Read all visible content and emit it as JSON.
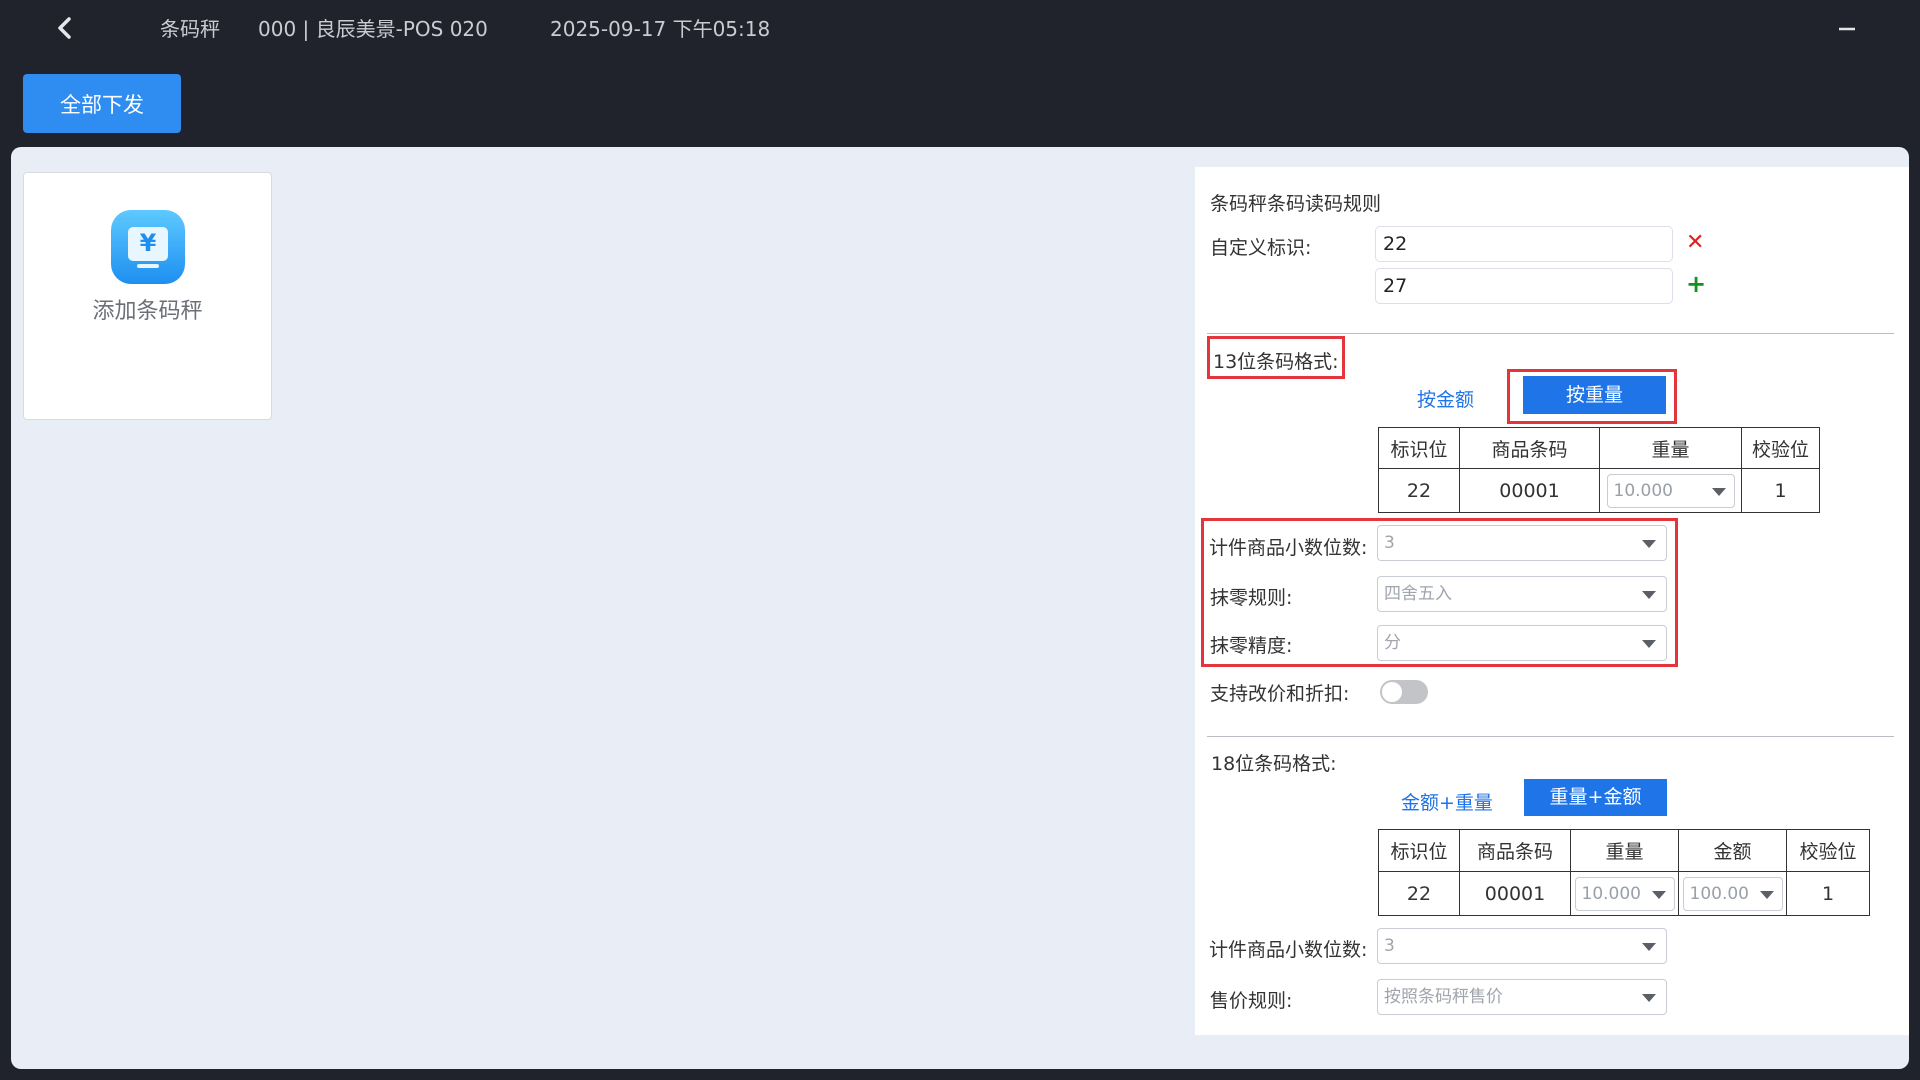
{
  "header": {
    "title": "条码秤",
    "store": "000 | 良辰美景-POS 020",
    "datetime": "2025-09-17 下午05:18"
  },
  "toolbar": {
    "issue_all_label": "全部下发"
  },
  "add_card": {
    "label": "添加条码秤",
    "icon": "yuan-monitor-icon"
  },
  "panel": {
    "title": "条码秤条码读码规则",
    "custom_id_label": "自定义标识:",
    "custom_ids": [
      "22",
      "27"
    ],
    "format13": {
      "label": "13位条码格式:",
      "tabs": [
        "按金额",
        "按重量"
      ],
      "active_tab": "按重量",
      "headers": [
        "标识位",
        "商品条码",
        "重量",
        "校验位"
      ],
      "row": {
        "id": "22",
        "code": "00001",
        "weight": "10.000",
        "check": "1"
      },
      "decimal_label": "计件商品小数位数:",
      "decimal_value": "3",
      "rounding_rule_label": "抹零规则:",
      "rounding_rule_value": "四舍五入",
      "rounding_precision_label": "抹零精度:",
      "rounding_precision_value": "分",
      "modify_price_label": "支持改价和折扣:",
      "modify_price_enabled": false
    },
    "format18": {
      "label": "18位条码格式:",
      "tabs": [
        "金额+重量",
        "重量+金额"
      ],
      "active_tab": "重量+金额",
      "headers": [
        "标识位",
        "商品条码",
        "重量",
        "金额",
        "校验位"
      ],
      "row": {
        "id": "22",
        "code": "00001",
        "weight": "10.000",
        "amount": "100.00",
        "check": "1"
      },
      "decimal_label": "计件商品小数位数:",
      "decimal_value": "3",
      "price_rule_label": "售价规则:",
      "price_rule_value": "按照条码秤售价"
    }
  },
  "colors": {
    "accent": "#1f74e8",
    "button": "#2f8cf0",
    "highlight": "#e4343c",
    "dark_bg": "#20232b",
    "content_bg": "#e9eef6"
  }
}
